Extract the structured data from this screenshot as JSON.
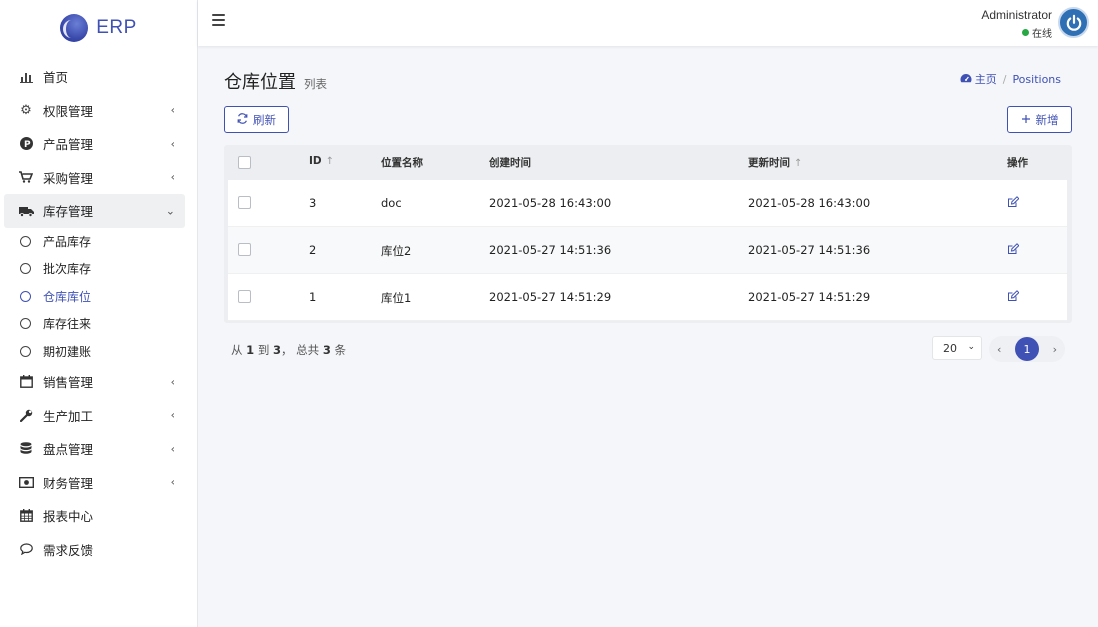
{
  "brand": {
    "name": "ERP"
  },
  "sidebar": {
    "items": [
      {
        "label": "首页",
        "icon": "bar-chart-icon"
      },
      {
        "label": "权限管理",
        "icon": "gear-icon"
      },
      {
        "label": "产品管理",
        "icon": "p-badge-icon"
      },
      {
        "label": "采购管理",
        "icon": "cart-icon"
      },
      {
        "label": "库存管理",
        "icon": "truck-icon",
        "open": true
      },
      {
        "label": "销售管理",
        "icon": "calendar-icon"
      },
      {
        "label": "生产加工",
        "icon": "wrench-icon"
      },
      {
        "label": "盘点管理",
        "icon": "database-icon"
      },
      {
        "label": "财务管理",
        "icon": "money-icon"
      },
      {
        "label": "报表中心",
        "icon": "calendar-grid-icon"
      },
      {
        "label": "需求反馈",
        "icon": "comment-icon"
      }
    ],
    "inventory_sub": [
      {
        "label": "产品库存"
      },
      {
        "label": "批次库存"
      },
      {
        "label": "仓库库位",
        "active": true
      },
      {
        "label": "库存往来"
      },
      {
        "label": "期初建账"
      }
    ]
  },
  "header": {
    "user_name": "Administrator",
    "status": "在线"
  },
  "page": {
    "title": "仓库位置",
    "subtitle": "列表",
    "breadcrumb_home": "主页",
    "breadcrumb_sep": "/",
    "breadcrumb_current": "Positions",
    "refresh_label": "刷新",
    "add_label": "新增"
  },
  "table": {
    "columns": {
      "id": "ID",
      "name": "位置名称",
      "created": "创建时间",
      "updated": "更新时间",
      "actions": "操作"
    },
    "rows": [
      {
        "id": "3",
        "name": "doc",
        "created": "2021-05-28 16:43:00",
        "updated": "2021-05-28 16:43:00"
      },
      {
        "id": "2",
        "name": "库位2",
        "created": "2021-05-27 14:51:36",
        "updated": "2021-05-27 14:51:36"
      },
      {
        "id": "1",
        "name": "库位1",
        "created": "2021-05-27 14:51:29",
        "updated": "2021-05-27 14:51:29"
      }
    ]
  },
  "pager": {
    "from_text": "从",
    "from": "1",
    "to_text": "到",
    "to": "3",
    "total_text": "， 总共",
    "total": "3",
    "unit": "条",
    "page_size": "20",
    "current_page": "1"
  },
  "colors": {
    "accent": "#3f51b5",
    "online": "#28a745"
  }
}
